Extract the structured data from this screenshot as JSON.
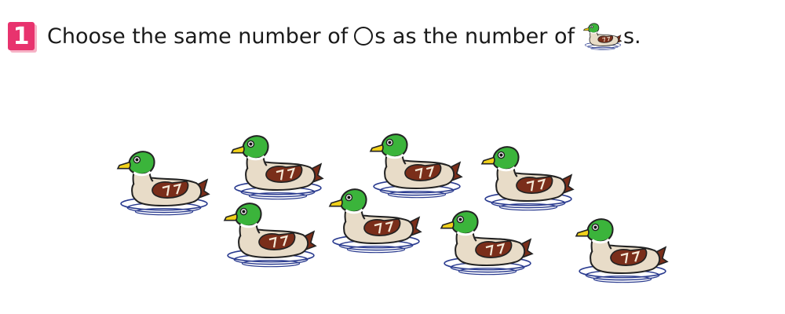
{
  "question": {
    "number": "1",
    "text_before": "Choose the same number of",
    "text_middle": "s as the number of",
    "text_after": "s."
  },
  "icons": {
    "circle": "circle-outline-icon",
    "duck": "duck-icon"
  },
  "colors": {
    "badge": "#e8336e",
    "duck_head": "#3bb43b",
    "duck_body": "#e8dcc8",
    "duck_wing": "#7a2e1a",
    "duck_bill": "#f2d21a",
    "water": "#2a3b8f"
  },
  "duck_count": 8
}
